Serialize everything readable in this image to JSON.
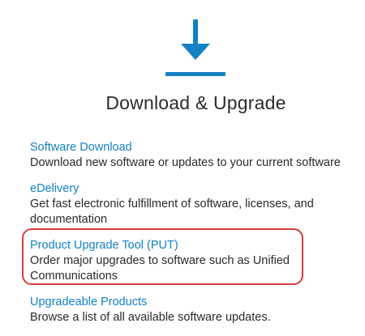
{
  "header": {
    "icon": "download-arrow-icon",
    "title": "Download & Upgrade"
  },
  "links": [
    {
      "title": "Software Download",
      "description": "Download new software or updates to your current software"
    },
    {
      "title": "eDelivery",
      "description": "Get fast electronic fulfillment of software, licenses, and documentation"
    },
    {
      "title": "Product Upgrade Tool (PUT)",
      "description": "Order major upgrades to software such as Unified Communications"
    },
    {
      "title": "Upgradeable Products",
      "description": "Browse a list of all available software updates."
    }
  ],
  "colors": {
    "accent": "#1580c4",
    "highlight": "#d53d3a"
  }
}
